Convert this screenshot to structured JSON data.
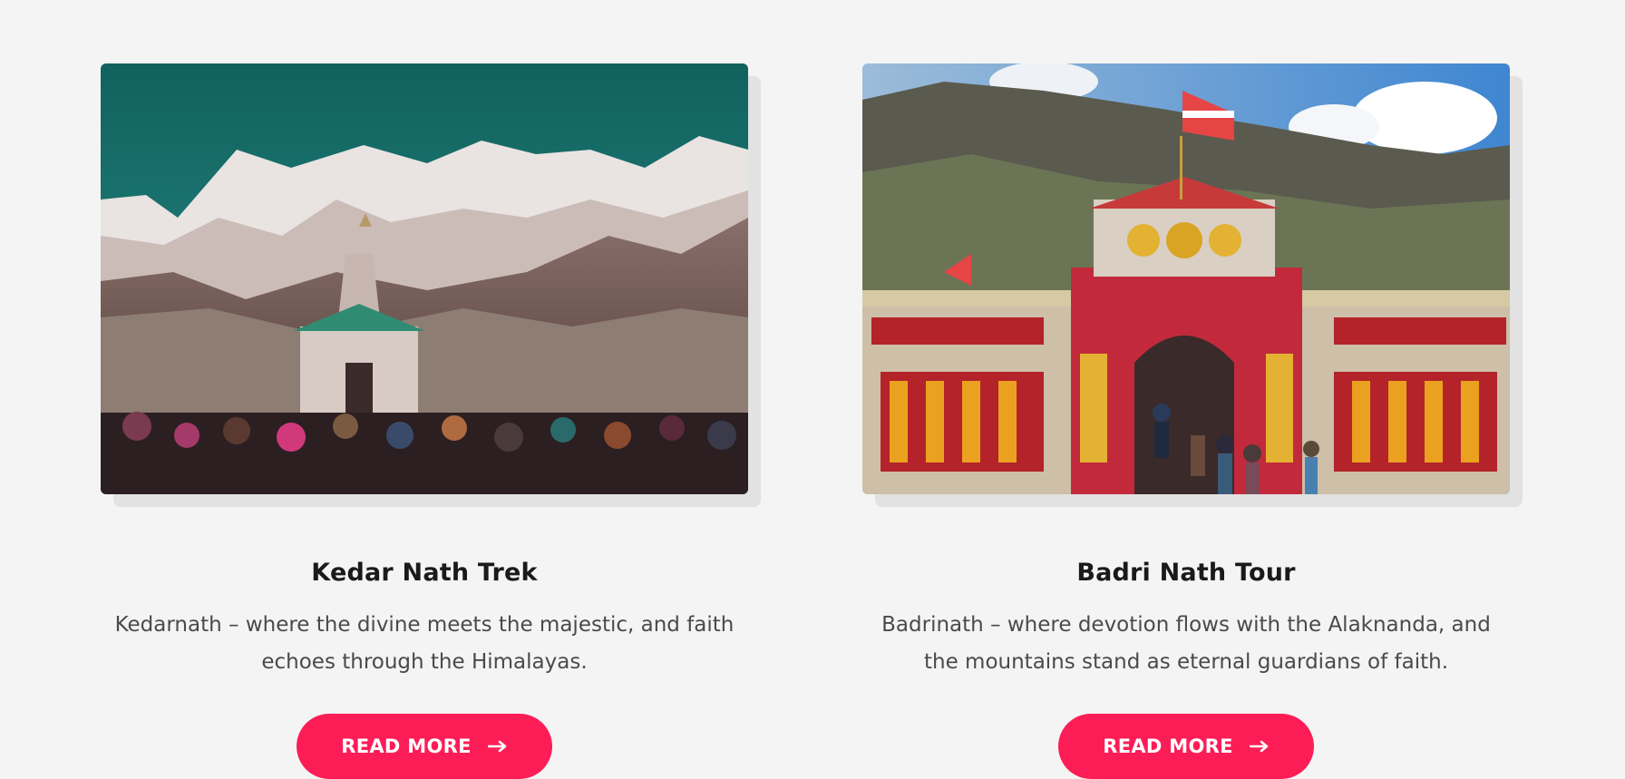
{
  "cards": [
    {
      "title": "Kedar Nath Trek",
      "description": "Kedarnath – where the divine meets the majestic, and faith echoes through the Himalayas.",
      "button_label": "READ MORE",
      "image_subject": "Kedarnath temple with snow-capped Himalayan peaks and crowd"
    },
    {
      "title": "Badri Nath Tour",
      "description": "Badrinath – where devotion flows with the Alaknanda, and the mountains stand as eternal guardians of faith.",
      "button_label": "READ MORE",
      "image_subject": "Colorful Badrinath temple facade with flags and mountains"
    }
  ],
  "colors": {
    "button": "#fc1d57",
    "page_bg": "#f4f4f4",
    "title": "#1a1a1a",
    "text": "#4a4a4a"
  },
  "icons": {
    "button_icon": "arrow-right-icon"
  }
}
